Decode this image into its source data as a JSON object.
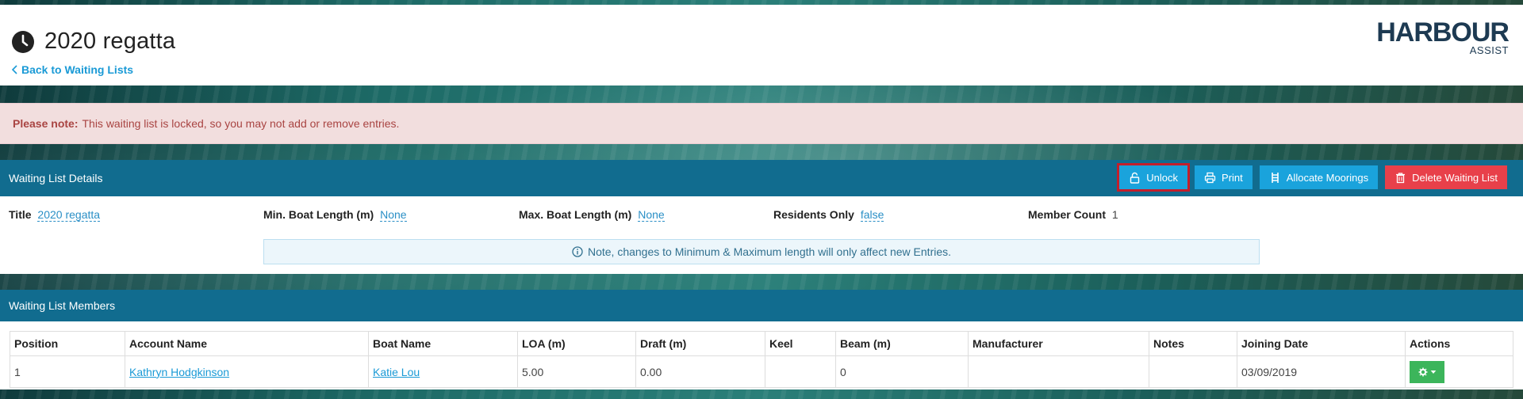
{
  "header": {
    "title": "2020 regatta",
    "back_link": "Back to Waiting Lists",
    "logo_main": "HARBOUR",
    "logo_sub": "ASSIST"
  },
  "alert": {
    "strong": "Please note:",
    "text": "This waiting list is locked, so you may not add or remove entries."
  },
  "details_panel": {
    "heading": "Waiting List Details",
    "buttons": {
      "unlock": "Unlock",
      "print": "Print",
      "allocate": "Allocate Moorings",
      "delete": "Delete Waiting List"
    },
    "fields": {
      "title_label": "Title",
      "title_value": "2020 regatta",
      "min_label": "Min. Boat Length (m)",
      "min_value": "None",
      "max_label": "Max. Boat Length (m)",
      "max_value": "None",
      "residents_label": "Residents Only",
      "residents_value": "false",
      "count_label": "Member Count",
      "count_value": "1"
    },
    "note": "Note, changes to Minimum & Maximum length will only affect new Entries."
  },
  "members_panel": {
    "heading": "Waiting List Members",
    "columns": [
      "Position",
      "Account Name",
      "Boat Name",
      "LOA (m)",
      "Draft (m)",
      "Keel",
      "Beam (m)",
      "Manufacturer",
      "Notes",
      "Joining Date",
      "Actions"
    ],
    "rows": [
      {
        "position": "1",
        "account_name": "Kathryn Hodgkinson",
        "boat_name": "Katie Lou",
        "loa": "5.00",
        "draft": "0.00",
        "keel": "",
        "beam": "0",
        "manufacturer": "",
        "notes": "",
        "joining_date": "03/09/2019"
      }
    ]
  },
  "colors": {
    "panel_heading": "#116c8f",
    "info_button": "#1aa3dc",
    "danger_button": "#e8404a",
    "action_button": "#3cb55b",
    "link": "#1a9ad6",
    "alert_bg": "#f2dede",
    "alert_text": "#a94442"
  },
  "icons": {
    "title": "clock-icon",
    "back": "chevron-left-icon",
    "unlock": "unlock-icon",
    "print": "printer-icon",
    "allocate": "ladder-icon",
    "delete": "trash-icon",
    "note": "info-circle-icon",
    "actions": "gear-icon"
  }
}
